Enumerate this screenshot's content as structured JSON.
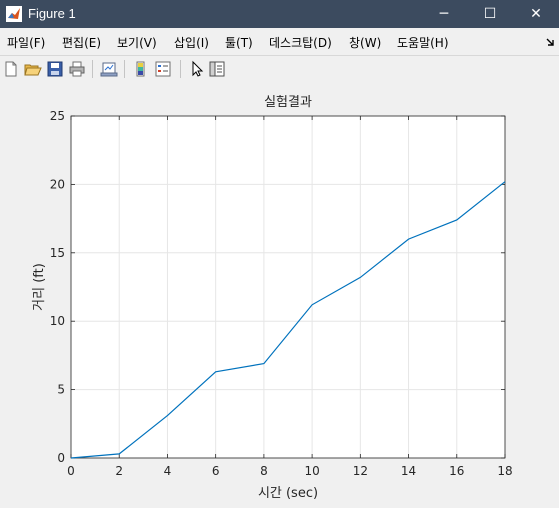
{
  "window": {
    "title": "Figure 1",
    "controls": {
      "minimize": "─",
      "maximize": "☐",
      "close": "✕"
    }
  },
  "menubar": {
    "items": [
      "파일(F)",
      "편집(E)",
      "보기(V)",
      "삽입(I)",
      "툴(T)",
      "데스크탑(D)",
      "창(W)",
      "도움말(H)"
    ],
    "overflow_icon": "dock-arrow-icon"
  },
  "toolbar": {
    "tools": [
      "new-figure-icon",
      "open-file-icon",
      "save-icon",
      "print-icon",
      "link-plot-icon",
      "colorbar-icon",
      "legend-icon",
      "edit-plot-icon",
      "property-inspector-icon"
    ]
  },
  "colors": {
    "titlebar": "#3c4b5f",
    "line": "#0072bd",
    "grid": "#e6e6e6"
  },
  "chart_data": {
    "type": "line",
    "title": "실험결과",
    "xlabel": "시간 (sec)",
    "ylabel": "거리 (ft)",
    "xlim": [
      0,
      18
    ],
    "ylim": [
      0,
      25
    ],
    "grid": true,
    "xticks": [
      0,
      2,
      4,
      6,
      8,
      10,
      12,
      14,
      16,
      18
    ],
    "yticks": [
      0,
      5,
      10,
      15,
      20,
      25
    ],
    "x": [
      0,
      2,
      4,
      6,
      8,
      10,
      12,
      14,
      16,
      18
    ],
    "y": [
      0,
      0.3,
      3.1,
      6.3,
      6.9,
      11.2,
      13.2,
      16.0,
      17.4,
      20.2
    ]
  }
}
